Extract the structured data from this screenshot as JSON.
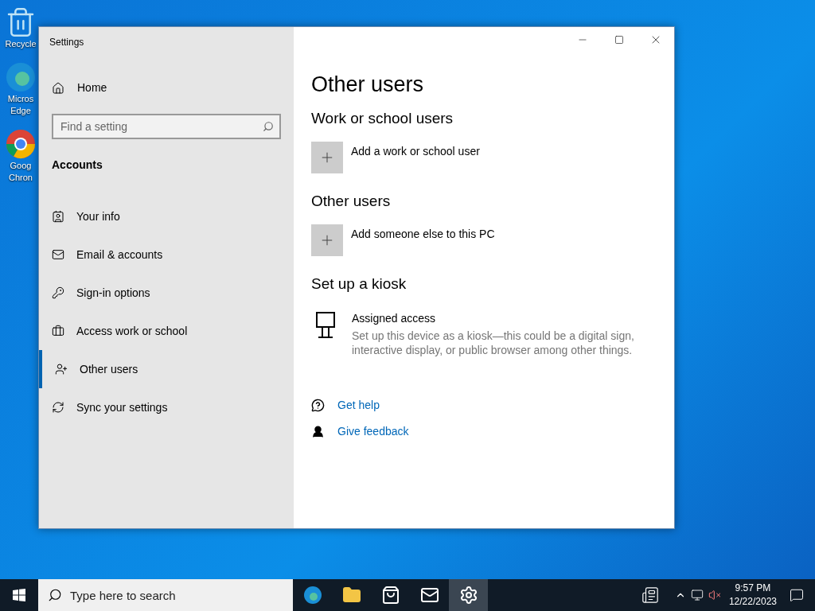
{
  "desktop_icons": [
    {
      "label_lines": [
        "Recycle"
      ]
    },
    {
      "label_lines": [
        "Micros",
        "Edge"
      ]
    },
    {
      "label_lines": [
        "Goog",
        "Chron"
      ]
    }
  ],
  "window": {
    "title": "Settings"
  },
  "sidebar": {
    "home": "Home",
    "search": {
      "placeholder": "Find a setting"
    },
    "section": "Accounts",
    "items": [
      {
        "label": "Your info",
        "selected": false
      },
      {
        "label": "Email & accounts",
        "selected": false
      },
      {
        "label": "Sign-in options",
        "selected": false
      },
      {
        "label": "Access work or school",
        "selected": false
      },
      {
        "label": "Other users",
        "selected": true
      },
      {
        "label": "Sync your settings",
        "selected": false
      }
    ]
  },
  "content": {
    "title": "Other users",
    "sections": [
      {
        "heading": "Work or school users",
        "kind": "add",
        "action": "Add a work or school user"
      },
      {
        "heading": "Other users",
        "kind": "add",
        "action": "Add someone else to this PC"
      },
      {
        "heading": "Set up a kiosk",
        "kind": "kiosk",
        "action": "Assigned access",
        "description": "Set up this device as a kiosk—this could be a digital sign, interactive display, or public browser among other things."
      }
    ],
    "links": [
      "Get help",
      "Give feedback"
    ]
  },
  "taskbar": {
    "search": {
      "placeholder": "Type here to search"
    },
    "apps": [
      {
        "selected": false
      },
      {
        "selected": false
      },
      {
        "selected": false
      },
      {
        "selected": false
      },
      {
        "selected": true
      }
    ],
    "time": "9:57 PM",
    "date": "12/22/2023"
  }
}
